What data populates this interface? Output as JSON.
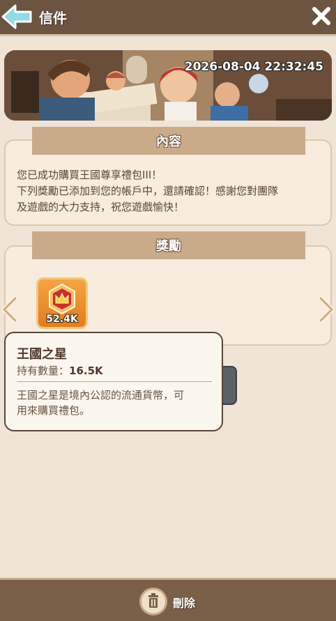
{
  "header": {
    "title": "信件",
    "back_icon": "back-arrow-icon",
    "close_icon": "close-icon"
  },
  "banner": {
    "date": "2026-08-04 22:32:45"
  },
  "content_panel": {
    "title": "內容",
    "line1": "您已成功購買王國尊享禮包III！",
    "line2": "下列獎勵已添加到您的帳戶中，還請確認！感謝您對團隊",
    "line3": "及遊戲的大力支持，祝您遊戲愉快！"
  },
  "reward_panel": {
    "title": "獎勵",
    "items": [
      {
        "icon": "crown-badge-icon",
        "quantity": "52.4K"
      }
    ]
  },
  "tooltip": {
    "title": "王國之星",
    "count_label": "持有數量：",
    "count_value": "16.5K",
    "desc_line1": "王國之星是境內公認的流通貨幣，可",
    "desc_line2": "用來購買禮包。"
  },
  "footer": {
    "delete_label": "刪除",
    "delete_icon": "trash-icon"
  },
  "colors": {
    "header_bg": "#6b5440",
    "panel_bg": "#f7ecde",
    "panel_header": "#c9ab8a",
    "accent_orange": "#e07d1f"
  }
}
